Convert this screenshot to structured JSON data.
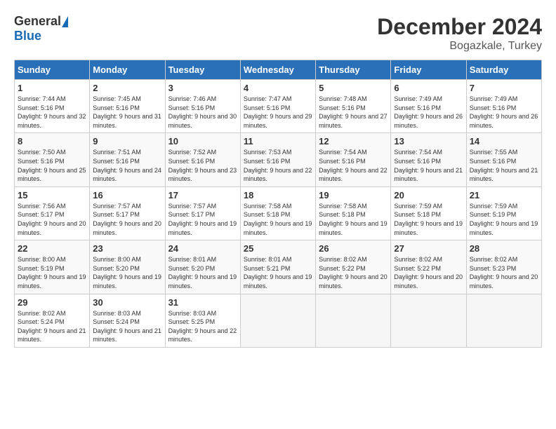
{
  "header": {
    "logo_general": "General",
    "logo_blue": "Blue",
    "month_title": "December 2024",
    "location": "Bogazkale, Turkey"
  },
  "days_of_week": [
    "Sunday",
    "Monday",
    "Tuesday",
    "Wednesday",
    "Thursday",
    "Friday",
    "Saturday"
  ],
  "weeks": [
    [
      {
        "day": "1",
        "sunrise": "7:44 AM",
        "sunset": "5:16 PM",
        "daylight": "9 hours and 32 minutes."
      },
      {
        "day": "2",
        "sunrise": "7:45 AM",
        "sunset": "5:16 PM",
        "daylight": "9 hours and 31 minutes."
      },
      {
        "day": "3",
        "sunrise": "7:46 AM",
        "sunset": "5:16 PM",
        "daylight": "9 hours and 30 minutes."
      },
      {
        "day": "4",
        "sunrise": "7:47 AM",
        "sunset": "5:16 PM",
        "daylight": "9 hours and 29 minutes."
      },
      {
        "day": "5",
        "sunrise": "7:48 AM",
        "sunset": "5:16 PM",
        "daylight": "9 hours and 27 minutes."
      },
      {
        "day": "6",
        "sunrise": "7:49 AM",
        "sunset": "5:16 PM",
        "daylight": "9 hours and 26 minutes."
      },
      {
        "day": "7",
        "sunrise": "7:49 AM",
        "sunset": "5:16 PM",
        "daylight": "9 hours and 26 minutes."
      }
    ],
    [
      {
        "day": "8",
        "sunrise": "7:50 AM",
        "sunset": "5:16 PM",
        "daylight": "9 hours and 25 minutes."
      },
      {
        "day": "9",
        "sunrise": "7:51 AM",
        "sunset": "5:16 PM",
        "daylight": "9 hours and 24 minutes."
      },
      {
        "day": "10",
        "sunrise": "7:52 AM",
        "sunset": "5:16 PM",
        "daylight": "9 hours and 23 minutes."
      },
      {
        "day": "11",
        "sunrise": "7:53 AM",
        "sunset": "5:16 PM",
        "daylight": "9 hours and 22 minutes."
      },
      {
        "day": "12",
        "sunrise": "7:54 AM",
        "sunset": "5:16 PM",
        "daylight": "9 hours and 22 minutes."
      },
      {
        "day": "13",
        "sunrise": "7:54 AM",
        "sunset": "5:16 PM",
        "daylight": "9 hours and 21 minutes."
      },
      {
        "day": "14",
        "sunrise": "7:55 AM",
        "sunset": "5:16 PM",
        "daylight": "9 hours and 21 minutes."
      }
    ],
    [
      {
        "day": "15",
        "sunrise": "7:56 AM",
        "sunset": "5:17 PM",
        "daylight": "9 hours and 20 minutes."
      },
      {
        "day": "16",
        "sunrise": "7:57 AM",
        "sunset": "5:17 PM",
        "daylight": "9 hours and 20 minutes."
      },
      {
        "day": "17",
        "sunrise": "7:57 AM",
        "sunset": "5:17 PM",
        "daylight": "9 hours and 19 minutes."
      },
      {
        "day": "18",
        "sunrise": "7:58 AM",
        "sunset": "5:18 PM",
        "daylight": "9 hours and 19 minutes."
      },
      {
        "day": "19",
        "sunrise": "7:58 AM",
        "sunset": "5:18 PM",
        "daylight": "9 hours and 19 minutes."
      },
      {
        "day": "20",
        "sunrise": "7:59 AM",
        "sunset": "5:18 PM",
        "daylight": "9 hours and 19 minutes."
      },
      {
        "day": "21",
        "sunrise": "7:59 AM",
        "sunset": "5:19 PM",
        "daylight": "9 hours and 19 minutes."
      }
    ],
    [
      {
        "day": "22",
        "sunrise": "8:00 AM",
        "sunset": "5:19 PM",
        "daylight": "9 hours and 19 minutes."
      },
      {
        "day": "23",
        "sunrise": "8:00 AM",
        "sunset": "5:20 PM",
        "daylight": "9 hours and 19 minutes."
      },
      {
        "day": "24",
        "sunrise": "8:01 AM",
        "sunset": "5:20 PM",
        "daylight": "9 hours and 19 minutes."
      },
      {
        "day": "25",
        "sunrise": "8:01 AM",
        "sunset": "5:21 PM",
        "daylight": "9 hours and 19 minutes."
      },
      {
        "day": "26",
        "sunrise": "8:02 AM",
        "sunset": "5:22 PM",
        "daylight": "9 hours and 20 minutes."
      },
      {
        "day": "27",
        "sunrise": "8:02 AM",
        "sunset": "5:22 PM",
        "daylight": "9 hours and 20 minutes."
      },
      {
        "day": "28",
        "sunrise": "8:02 AM",
        "sunset": "5:23 PM",
        "daylight": "9 hours and 20 minutes."
      }
    ],
    [
      {
        "day": "29",
        "sunrise": "8:02 AM",
        "sunset": "5:24 PM",
        "daylight": "9 hours and 21 minutes."
      },
      {
        "day": "30",
        "sunrise": "8:03 AM",
        "sunset": "5:24 PM",
        "daylight": "9 hours and 21 minutes."
      },
      {
        "day": "31",
        "sunrise": "8:03 AM",
        "sunset": "5:25 PM",
        "daylight": "9 hours and 22 minutes."
      },
      null,
      null,
      null,
      null
    ]
  ]
}
